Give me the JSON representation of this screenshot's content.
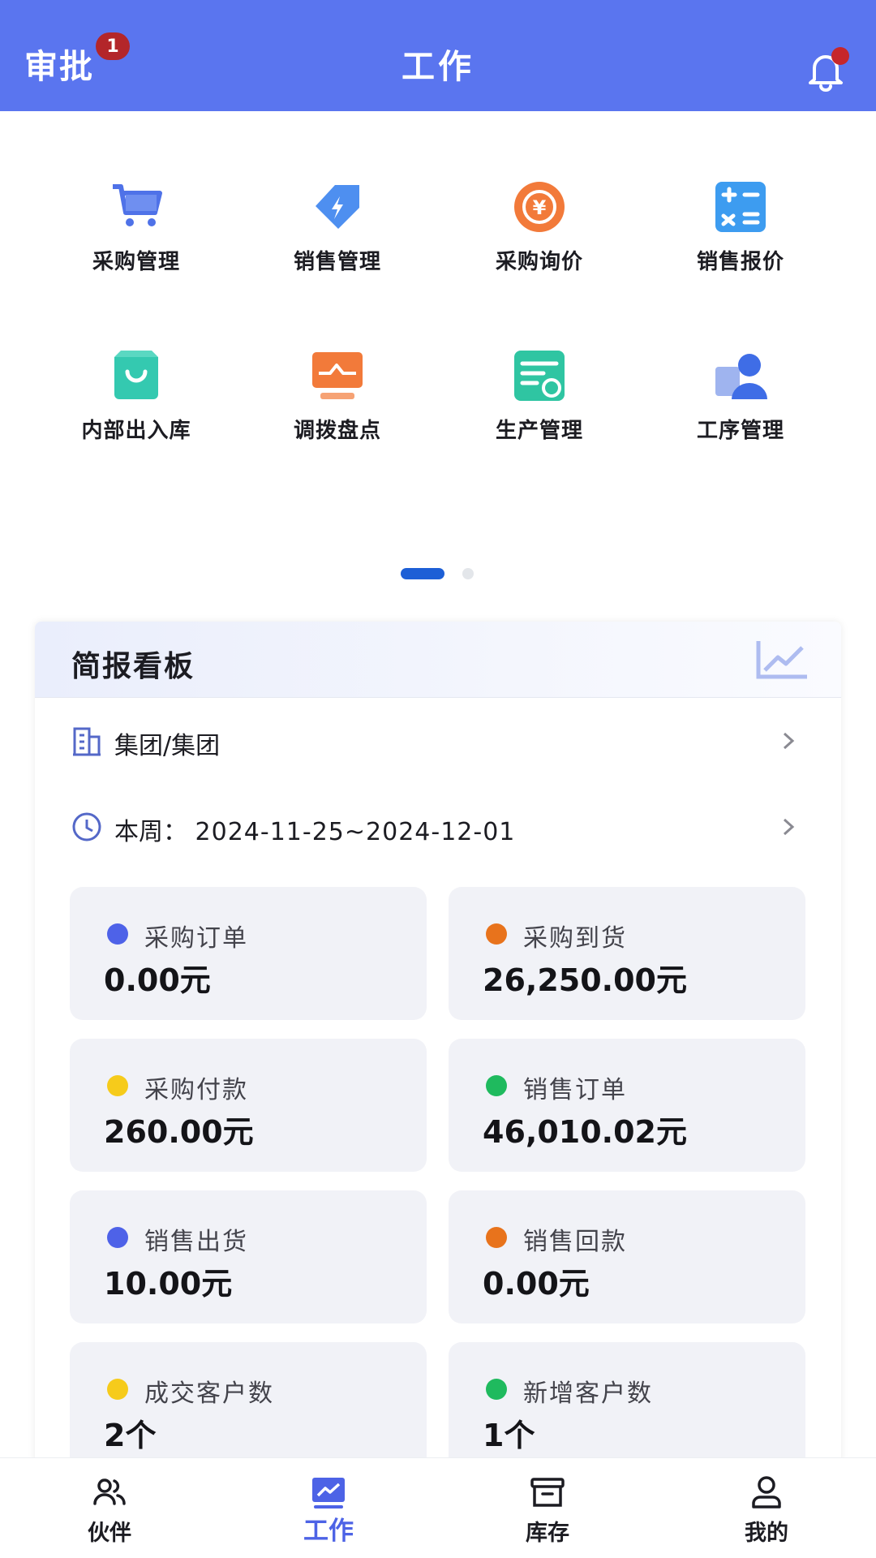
{
  "header": {
    "left_label": "审批",
    "badge_count": "1",
    "title": "工作",
    "colors": {
      "background": "#5a75ef",
      "badge": "#b3262a"
    },
    "bell_icon": "bell-icon"
  },
  "quick_actions": [
    {
      "label": "采购管理",
      "icon": "shopping-cart-icon"
    },
    {
      "label": "销售管理",
      "icon": "tag-icon"
    },
    {
      "label": "采购询价",
      "icon": "currency-exchange-icon"
    },
    {
      "label": "销售报价",
      "icon": "calculator-icon"
    },
    {
      "label": "内部出入库",
      "icon": "shopping-bag-icon"
    },
    {
      "label": "调拨盘点",
      "icon": "monitor-icon"
    },
    {
      "label": "生产管理",
      "icon": "production-icon"
    },
    {
      "label": "工序管理",
      "icon": "worker-icon"
    }
  ],
  "pager": {
    "pages": 2,
    "current": 1
  },
  "board": {
    "title": "简报看板",
    "org": "集团/集团",
    "period_label": "本周：",
    "period_value": "2024-11-25~2024-12-01",
    "stats": [
      {
        "label": "采购订单",
        "value": "0.00元",
        "color": "#4e62e8"
      },
      {
        "label": "采购到货",
        "value": "26,250.00元",
        "color": "#e8731c"
      },
      {
        "label": "采购付款",
        "value": "260.00元",
        "color": "#f6cb1b"
      },
      {
        "label": "销售订单",
        "value": "46,010.02元",
        "color": "#1fba5e"
      },
      {
        "label": "销售出货",
        "value": "10.00元",
        "color": "#4e62e8"
      },
      {
        "label": "销售回款",
        "value": "0.00元",
        "color": "#e8731c"
      },
      {
        "label": "成交客户数",
        "value": "2个",
        "color": "#f6cb1b"
      },
      {
        "label": "新增客户数",
        "value": "1个",
        "color": "#1fba5e"
      }
    ]
  },
  "tabbar": {
    "active_color": "#4d63e6",
    "items": [
      {
        "label": "伙伴",
        "icon": "partners-icon"
      },
      {
        "label": "工作",
        "icon": "work-chart-icon",
        "active": true
      },
      {
        "label": "库存",
        "icon": "inventory-box-icon"
      },
      {
        "label": "我的",
        "icon": "profile-icon"
      }
    ]
  }
}
